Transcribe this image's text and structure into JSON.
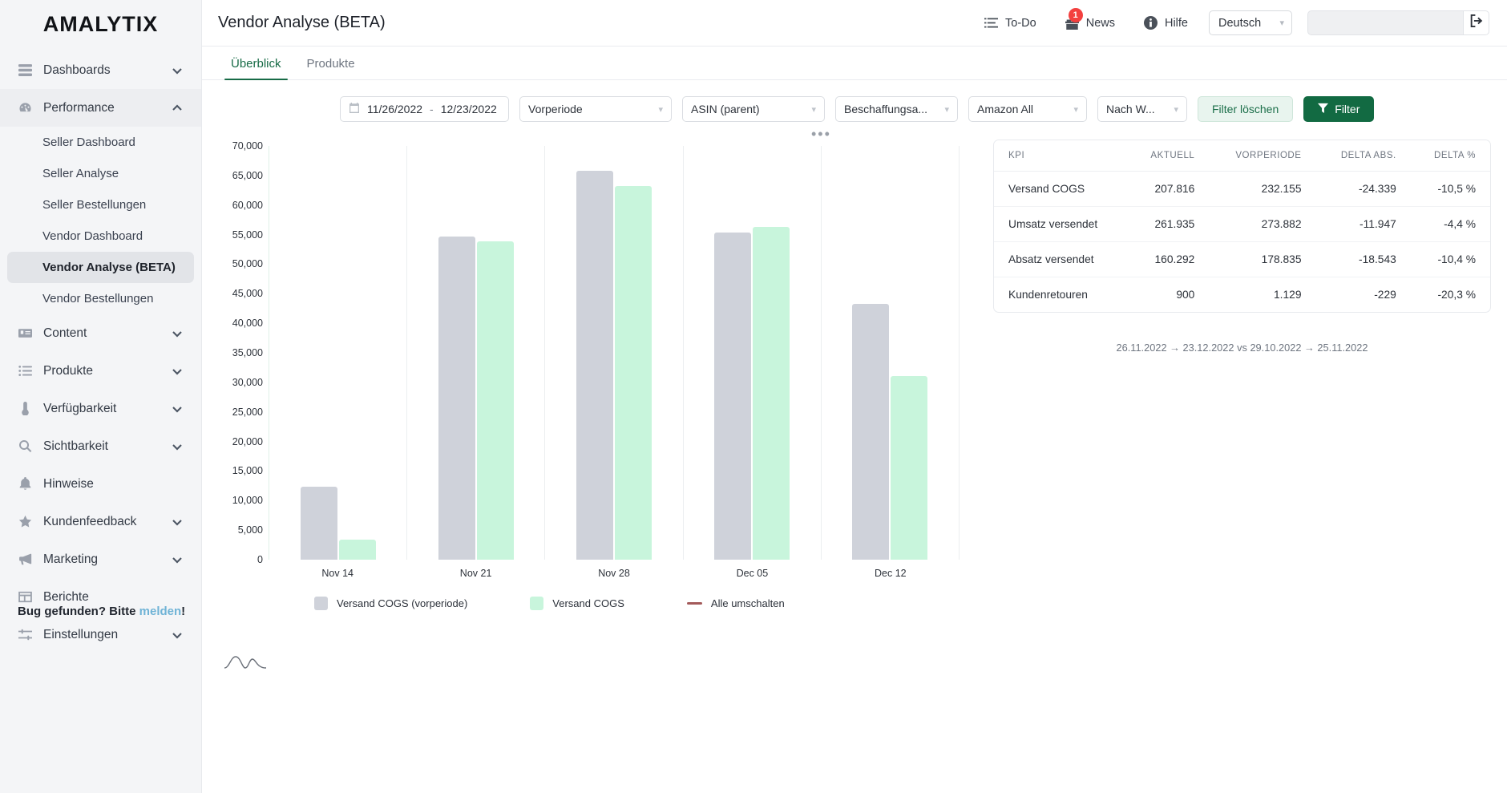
{
  "brand": {
    "name": "AMALYTIX"
  },
  "sidebar": {
    "groups": [
      {
        "label": "Dashboards",
        "icon": "dashboards-icon",
        "expanded": false,
        "items": []
      },
      {
        "label": "Performance",
        "icon": "performance-icon",
        "expanded": true,
        "items": [
          {
            "label": "Seller Dashboard",
            "selected": false
          },
          {
            "label": "Seller Analyse",
            "selected": false
          },
          {
            "label": "Seller Bestellungen",
            "selected": false
          },
          {
            "label": "Vendor Dashboard",
            "selected": false
          },
          {
            "label": "Vendor Analyse (BETA)",
            "selected": true
          },
          {
            "label": "Vendor Bestellungen",
            "selected": false
          }
        ]
      },
      {
        "label": "Content",
        "icon": "content-icon",
        "expanded": false,
        "items": []
      },
      {
        "label": "Produkte",
        "icon": "products-icon",
        "expanded": false,
        "items": []
      },
      {
        "label": "Verfügbarkeit",
        "icon": "availability-icon",
        "expanded": false,
        "items": []
      },
      {
        "label": "Sichtbarkeit",
        "icon": "visibility-icon",
        "expanded": false,
        "items": []
      },
      {
        "label": "Hinweise",
        "icon": "bell-icon",
        "expanded": null,
        "items": []
      },
      {
        "label": "Kundenfeedback",
        "icon": "star-icon",
        "expanded": false,
        "items": []
      },
      {
        "label": "Marketing",
        "icon": "megaphone-icon",
        "expanded": false,
        "items": []
      },
      {
        "label": "Berichte",
        "icon": "reports-icon",
        "expanded": null,
        "items": []
      },
      {
        "label": "Einstellungen",
        "icon": "settings-icon",
        "expanded": false,
        "items": []
      }
    ],
    "bug_prompt": "Bug gefunden? Bitte ",
    "bug_link": "melden",
    "bug_suffix": "!"
  },
  "header": {
    "title": "Vendor Analyse (BETA)",
    "todo_label": "To-Do",
    "news_label": "News",
    "news_badge": "1",
    "help_label": "Hilfe",
    "language": "Deutsch",
    "search_value": "",
    "search_placeholder": ""
  },
  "tabs": [
    {
      "label": "Überblick",
      "active": true
    },
    {
      "label": "Produkte",
      "active": false
    }
  ],
  "filters": {
    "date_from": "11/26/2022",
    "date_sep": "-",
    "date_to": "12/23/2022",
    "compare": "Vorperiode",
    "grouping": "ASIN (parent)",
    "source": "Beschaffungsa...",
    "marketplace": "Amazon All",
    "interval": "Nach W...",
    "clear_label": "Filter löschen",
    "apply_label": "Filter"
  },
  "kpi_table": {
    "columns": [
      "KPI",
      "AKTUELL",
      "VORPERIODE",
      "DELTA ABS.",
      "DELTA %"
    ],
    "rows": [
      {
        "kpi": "Versand COGS",
        "aktuell": "207.816",
        "vorperiode": "232.155",
        "delta_abs": "-24.339",
        "delta_pct": "-10,5 %"
      },
      {
        "kpi": "Umsatz versendet",
        "aktuell": "261.935",
        "vorperiode": "273.882",
        "delta_abs": "-11.947",
        "delta_pct": "-4,4 %"
      },
      {
        "kpi": "Absatz versendet",
        "aktuell": "160.292",
        "vorperiode": "178.835",
        "delta_abs": "-18.543",
        "delta_pct": "-10,4 %"
      },
      {
        "kpi": "Kundenretouren",
        "aktuell": "900",
        "vorperiode": "1.129",
        "delta_abs": "-229",
        "delta_pct": "-20,3 %"
      }
    ],
    "range_note": "26.11.2022 → 23.12.2022 vs 29.10.2022 → 25.11.2022"
  },
  "chart_menu": {
    "dots": "•••"
  },
  "chart_data": {
    "type": "bar",
    "title": "",
    "xlabel": "",
    "ylabel": "",
    "categories": [
      "Nov 14",
      "Nov 21",
      "Nov 28",
      "Dec 05",
      "Dec 12"
    ],
    "series": [
      {
        "name": "Versand COGS (vorperiode)",
        "color": "#cfd2da",
        "values": [
          12300,
          54700,
          65800,
          55300,
          43300
        ]
      },
      {
        "name": "Versand COGS",
        "color": "#c8f5dc",
        "values": [
          3400,
          53800,
          63200,
          56300,
          31100
        ]
      }
    ],
    "ylim": [
      0,
      70000
    ],
    "yticks": [
      "70,000",
      "65,000",
      "60,000",
      "55,000",
      "50,000",
      "45,000",
      "40,000",
      "35,000",
      "30,000",
      "25,000",
      "20,000",
      "15,000",
      "10,000",
      "5,000",
      "0"
    ],
    "ytick_values": [
      70000,
      65000,
      60000,
      55000,
      50000,
      45000,
      40000,
      35000,
      30000,
      25000,
      20000,
      15000,
      10000,
      5000,
      0
    ],
    "grid": "vertical-group-separators",
    "legend_position": "bottom",
    "legend": [
      {
        "label": "Versand COGS (vorperiode)",
        "type": "swatch",
        "color": "#cfd2da"
      },
      {
        "label": "Versand COGS",
        "type": "swatch",
        "color": "#c8f5dc"
      },
      {
        "label": "Alle umschalten",
        "type": "line",
        "color": "#a35a5a"
      }
    ]
  },
  "colors": {
    "accent_green": "#126a42",
    "tab_active": "#176b46",
    "badge_red": "#f3403f",
    "delta_negative": "#d6474d",
    "bar_previous": "#cfd2da",
    "bar_current": "#c8f5dc"
  }
}
